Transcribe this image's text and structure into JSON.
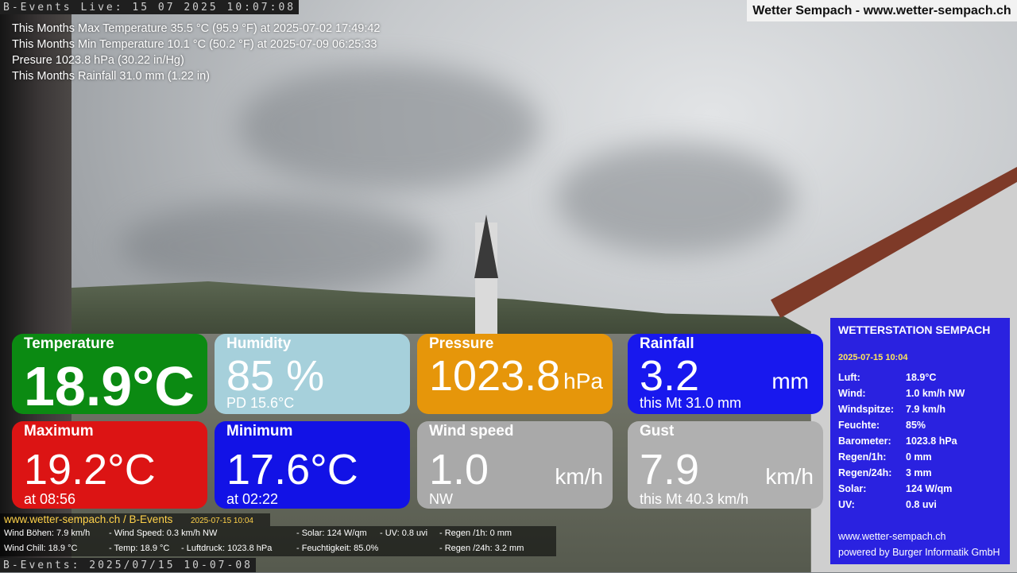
{
  "ticker_top": "B-Events Live: 15 07 2025 10:07:08",
  "ticker_bottom": "B-Events: 2025/07/15 10-07-08",
  "site_badge": "Wetter Sempach - www.wetter-sempach.ch",
  "stats": [
    "This Months Max Temperature 35.5 °C (95.9 °F) at 2025-07-02 17:49:42",
    "This Months Min Temperature 10.1 °C (50.2 °F) at 2025-07-09 06:25:33",
    "Presure 1023.8 hPa (30.22 in/Hg)",
    "This Months Rainfall 31.0 mm (1.22 in)"
  ],
  "tiles": {
    "temperature": {
      "label": "Temperature",
      "value": "18.9°C",
      "color": "#0b8a12"
    },
    "humidity": {
      "label": "Humidity",
      "value": "85 %",
      "sub": "PD 15.6°C",
      "color": "#a6d0db"
    },
    "pressure": {
      "label": "Pressure",
      "value": "1023.8",
      "unit": "hPa",
      "color": "#e6960a"
    },
    "rainfall": {
      "label": "Rainfall",
      "value": "3.2",
      "unit": "mm",
      "sub": "this Mt 31.0 mm",
      "color": "#1818ee"
    },
    "maximum": {
      "label": "Maximum",
      "value": "19.2°C",
      "sub": "at 08:56",
      "color": "#dc1414"
    },
    "minimum": {
      "label": "Minimum",
      "value": "17.6°C",
      "sub": "at 02:22",
      "color": "#1212e6"
    },
    "windspeed": {
      "label": "Wind speed",
      "value": "1.0",
      "unit": "km/h",
      "sub": "NW",
      "color": "#a9a9a9"
    },
    "gust": {
      "label": "Gust",
      "value": "7.9",
      "unit": "km/h",
      "sub": "this Mt 40.3 km/h",
      "color": "#b0b0b0"
    }
  },
  "panel": {
    "title": "WETTERSTATION SEMPACH",
    "date": "2025-07-15 10:04",
    "rows": [
      {
        "k": "Luft:",
        "v": "18.9°C"
      },
      {
        "k": "Wind:",
        "v": "1.0 km/h  NW"
      },
      {
        "k": "Windspitze:",
        "v": "7.9 km/h"
      },
      {
        "k": "Feuchte:",
        "v": "85%"
      },
      {
        "k": "Barometer:",
        "v": "1023.8 hPa"
      },
      {
        "k": "Regen/1h:",
        "v": "0 mm"
      },
      {
        "k": "Regen/24h:",
        "v": "3 mm"
      },
      {
        "k": "Solar:",
        "v": "124 W/qm"
      },
      {
        "k": "UV:",
        "v": "0.8 uvi"
      }
    ],
    "site": "www.wetter-sempach.ch",
    "powered": "powered by Burger Informatik GmbH"
  },
  "strip": {
    "url": "www.wetter-sempach.ch / B-Events",
    "datetime": "2025-07-15 10:04",
    "items": [
      "Wind Böhen: 7.9 km/h",
      "- Wind Speed: 0.3 km/h NW",
      "- Solar: 124 W/qm",
      "- UV: 0.8 uvi",
      "- Regen /1h:   0 mm",
      "Wind Chill: 18.9 °C",
      "- Temp: 18.9 °C",
      "- Luftdruck: 1023.8 hPa",
      "- Feuchtigkeit: 85.0%",
      "- Regen /24h: 3.2 mm"
    ]
  }
}
